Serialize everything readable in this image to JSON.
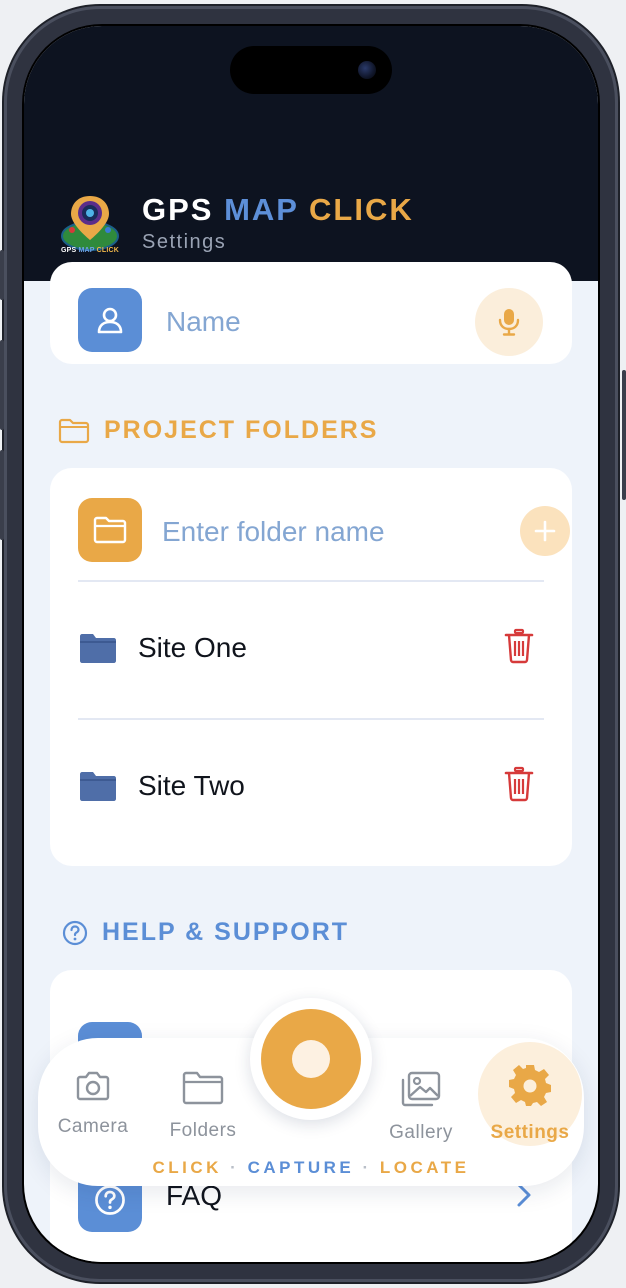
{
  "header": {
    "title_gps": "GPS",
    "title_map": "MAP",
    "title_click": "CLICK",
    "subtitle": "Settings",
    "logo": {
      "icon": "map-pin-camera-logo",
      "text_gps": "GPS",
      "text_map": "MAP",
      "text_click": "CLICK"
    }
  },
  "name_field": {
    "placeholder": "Name",
    "icon": "user-icon",
    "action_icon": "microphone-icon"
  },
  "project_folders": {
    "heading": "PROJECT FOLDERS",
    "heading_icon": "folder-outline-icon",
    "input_placeholder": "Enter folder name",
    "add_icon": "plus-icon",
    "folders": [
      {
        "name": "Site One",
        "icon": "folder-icon",
        "action_icon": "trash-icon"
      },
      {
        "name": "Site Two",
        "icon": "folder-icon",
        "action_icon": "trash-icon"
      }
    ]
  },
  "help_support": {
    "heading": "HELP & SUPPORT",
    "heading_icon": "question-circle-icon",
    "items": [
      {
        "label": "FAQ",
        "icon": "question-circle-icon",
        "action_icon": "chevron-right-icon"
      }
    ]
  },
  "bottom_nav": {
    "items": [
      {
        "label": "Camera",
        "icon": "camera-icon",
        "active": false
      },
      {
        "label": "Folders",
        "icon": "folder-icon",
        "active": false
      },
      {
        "label": "Gallery",
        "icon": "gallery-icon",
        "active": false
      },
      {
        "label": "Settings",
        "icon": "gear-icon",
        "active": true
      }
    ],
    "tagline_click": "CLICK",
    "tagline_capture": "CAPTURE",
    "tagline_locate": "LOCATE",
    "tagline_sep": "·"
  },
  "colors": {
    "accent_orange": "#e9a847",
    "accent_blue": "#5b8ed6",
    "header_bg": "#0d1320",
    "screen_bg": "#eef3fa",
    "danger_red": "#d63a3a"
  }
}
